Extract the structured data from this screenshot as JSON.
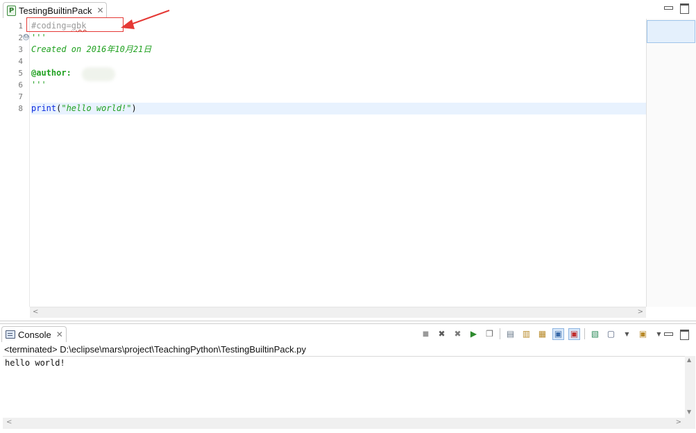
{
  "editor": {
    "tab": {
      "icon": "python-file-icon",
      "icon_glyph": "P",
      "label": "TestingBuiltinPack",
      "close_glyph": "✕"
    },
    "line_numbers": [
      "1",
      "2",
      "3",
      "4",
      "5",
      "6",
      "7",
      "8"
    ],
    "fold_glyph": "⊖",
    "lines": {
      "l1": "#coding=gbk",
      "l2": "'''",
      "l3": "Created on 2016年10月21日",
      "l5_tag": "@author:",
      "l6": "'''",
      "l8_kw": "print",
      "l8_open": "(",
      "l8_str": "\"hello world!\"",
      "l8_close": ")"
    },
    "annotation": {
      "highlight_color": "#e53935"
    },
    "scroll": {
      "left": "<",
      "right": ">"
    }
  },
  "console": {
    "tab": {
      "icon": "console-icon",
      "label": "Console",
      "close_glyph": "✕"
    },
    "status_path": "<terminated> D:\\eclipse\\mars\\project\\TeachingPython\\TestingBuiltinPack.py",
    "output": [
      "hello world!"
    ],
    "toolbar": [
      {
        "name": "terminate-icon",
        "glyph": "■"
      },
      {
        "name": "remove-launch-icon",
        "glyph": "✖"
      },
      {
        "name": "remove-all-launches-icon",
        "glyph": "✖"
      },
      {
        "name": "run-icon",
        "glyph": "▶"
      },
      {
        "name": "debug-icon",
        "glyph": "❐"
      },
      {
        "name": "clear-console-icon",
        "glyph": "▤"
      },
      {
        "name": "scroll-lock-icon",
        "glyph": "▥"
      },
      {
        "name": "word-wrap-icon",
        "glyph": "▦"
      },
      {
        "name": "show-on-stdout-icon",
        "glyph": "▣"
      },
      {
        "name": "show-on-stderr-icon",
        "glyph": "▣"
      },
      {
        "name": "pin-console-icon",
        "glyph": "▧"
      },
      {
        "name": "display-console-icon",
        "glyph": "▢"
      },
      {
        "name": "open-console-icon",
        "glyph": "▣"
      }
    ],
    "scroll": {
      "up": "▲",
      "down": "▼",
      "left": "<",
      "right": ">"
    }
  }
}
